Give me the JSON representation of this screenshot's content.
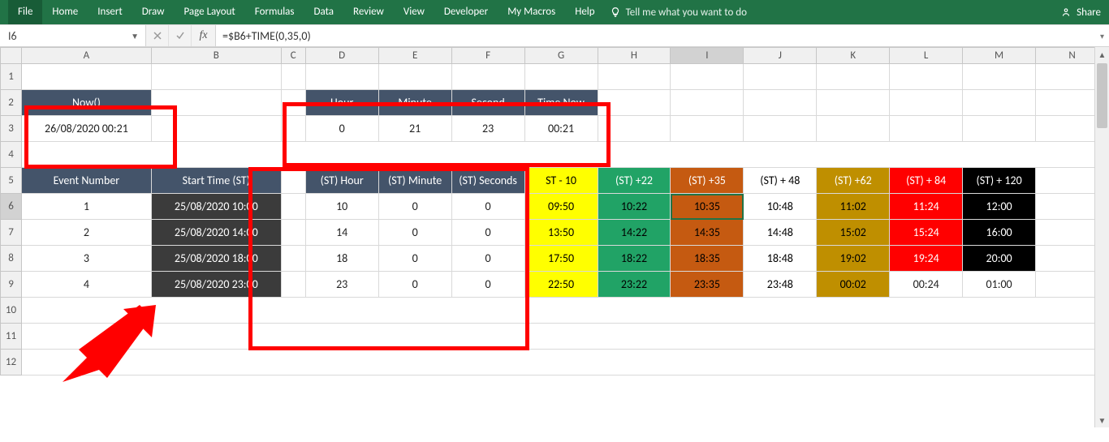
{
  "ribbon": {
    "tabs": [
      "File",
      "Home",
      "Insert",
      "Draw",
      "Page Layout",
      "Formulas",
      "Data",
      "Review",
      "View",
      "Developer",
      "My Macros",
      "Help"
    ],
    "tellme": "Tell me what you want to do",
    "share": "Share"
  },
  "formulaBar": {
    "cellRef": "I6",
    "fxLabel": "fx",
    "formula": "=$B6+TIME(0,35,0)"
  },
  "columns": [
    "A",
    "B",
    "C",
    "D",
    "E",
    "F",
    "G",
    "H",
    "I",
    "J",
    "K",
    "L",
    "M",
    "N"
  ],
  "rowCount": 12,
  "activeCell": "I6",
  "hdr1": {
    "now": "Now()",
    "hour": "Hour",
    "minute": "Minute",
    "second": "Second",
    "timenow": "Time Now"
  },
  "row3": {
    "now": "26/08/2020 00:21",
    "hour": "0",
    "minute": "21",
    "second": "23",
    "timenow": "00:21"
  },
  "hdr5": {
    "event": "Event Number",
    "start": "Start Time (ST)",
    "sth": "(ST) Hour",
    "stm": "(ST) Minute",
    "sts": "(ST) Seconds",
    "g": "ST - 10",
    "h": "(ST) +22",
    "i": "(ST) +35",
    "j": "(ST) + 48",
    "k": "(ST) +62",
    "l": "(ST) + 84",
    "m": "(ST) + 120"
  },
  "events": [
    {
      "n": "1",
      "start": "25/08/2020 10:00",
      "h": "10",
      "m": "0",
      "s": "0",
      "g": "09:50",
      "hh": "10:22",
      "i": "10:35",
      "j": "10:48",
      "k": "11:02",
      "l": "11:24",
      "mm": "12:00",
      "l_red": true
    },
    {
      "n": "2",
      "start": "25/08/2020 14:00",
      "h": "14",
      "m": "0",
      "s": "0",
      "g": "13:50",
      "hh": "14:22",
      "i": "14:35",
      "j": "14:48",
      "k": "15:02",
      "l": "15:24",
      "mm": "16:00",
      "l_red": true
    },
    {
      "n": "3",
      "start": "25/08/2020 18:00",
      "h": "18",
      "m": "0",
      "s": "0",
      "g": "17:50",
      "hh": "18:22",
      "i": "18:35",
      "j": "18:48",
      "k": "19:02",
      "l": "19:24",
      "mm": "20:00",
      "l_red": true
    },
    {
      "n": "4",
      "start": "25/08/2020 23:00",
      "h": "23",
      "m": "0",
      "s": "0",
      "g": "22:50",
      "hh": "23:22",
      "i": "23:35",
      "j": "23:48",
      "k": "00:02",
      "l": "00:24",
      "mm": "01:00",
      "l_red": false
    }
  ]
}
